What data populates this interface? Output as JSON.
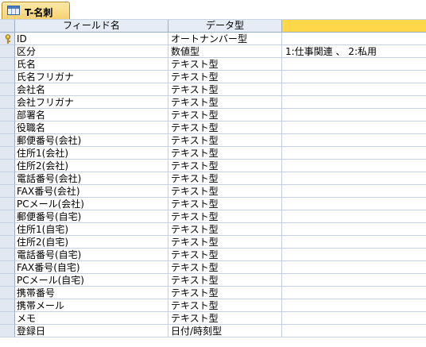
{
  "tab": {
    "label": "T-名刺",
    "icon": "table-icon"
  },
  "header": {
    "field_name": "フィールド名",
    "data_type": "データ型",
    "description": ""
  },
  "rows": [
    {
      "field": "ID",
      "type": "オートナンバー型",
      "desc": "",
      "primary_key": true
    },
    {
      "field": "区分",
      "type": "数値型",
      "desc": "1:仕事関連 、 2:私用"
    },
    {
      "field": "氏名",
      "type": "テキスト型",
      "desc": ""
    },
    {
      "field": "氏名フリガナ",
      "type": "テキスト型",
      "desc": ""
    },
    {
      "field": "会社名",
      "type": "テキスト型",
      "desc": ""
    },
    {
      "field": "会社フリガナ",
      "type": "テキスト型",
      "desc": ""
    },
    {
      "field": "部署名",
      "type": "テキスト型",
      "desc": ""
    },
    {
      "field": "役職名",
      "type": "テキスト型",
      "desc": ""
    },
    {
      "field": "郵便番号(会社)",
      "type": "テキスト型",
      "desc": ""
    },
    {
      "field": "住所1(会社)",
      "type": "テキスト型",
      "desc": ""
    },
    {
      "field": "住所2(会社)",
      "type": "テキスト型",
      "desc": ""
    },
    {
      "field": "電話番号(会社)",
      "type": "テキスト型",
      "desc": ""
    },
    {
      "field": "FAX番号(会社)",
      "type": "テキスト型",
      "desc": ""
    },
    {
      "field": "PCメール(会社)",
      "type": "テキスト型",
      "desc": ""
    },
    {
      "field": "郵便番号(自宅)",
      "type": "テキスト型",
      "desc": ""
    },
    {
      "field": "住所1(自宅)",
      "type": "テキスト型",
      "desc": ""
    },
    {
      "field": "住所2(自宅)",
      "type": "テキスト型",
      "desc": ""
    },
    {
      "field": "電話番号(自宅)",
      "type": "テキスト型",
      "desc": ""
    },
    {
      "field": "FAX番号(自宅)",
      "type": "テキスト型",
      "desc": ""
    },
    {
      "field": "PCメール(自宅)",
      "type": "テキスト型",
      "desc": ""
    },
    {
      "field": "携帯番号",
      "type": "テキスト型",
      "desc": ""
    },
    {
      "field": "携帯メール",
      "type": "テキスト型",
      "desc": ""
    },
    {
      "field": "メモ",
      "type": "テキスト型",
      "desc": ""
    },
    {
      "field": "登録日",
      "type": "日付/時刻型",
      "desc": ""
    }
  ],
  "colors": {
    "tab_active": "#f7d070",
    "header_bg": "#e6ecf5",
    "desc_header": "#ffd84a",
    "grid_line": "#c5d1e1"
  }
}
